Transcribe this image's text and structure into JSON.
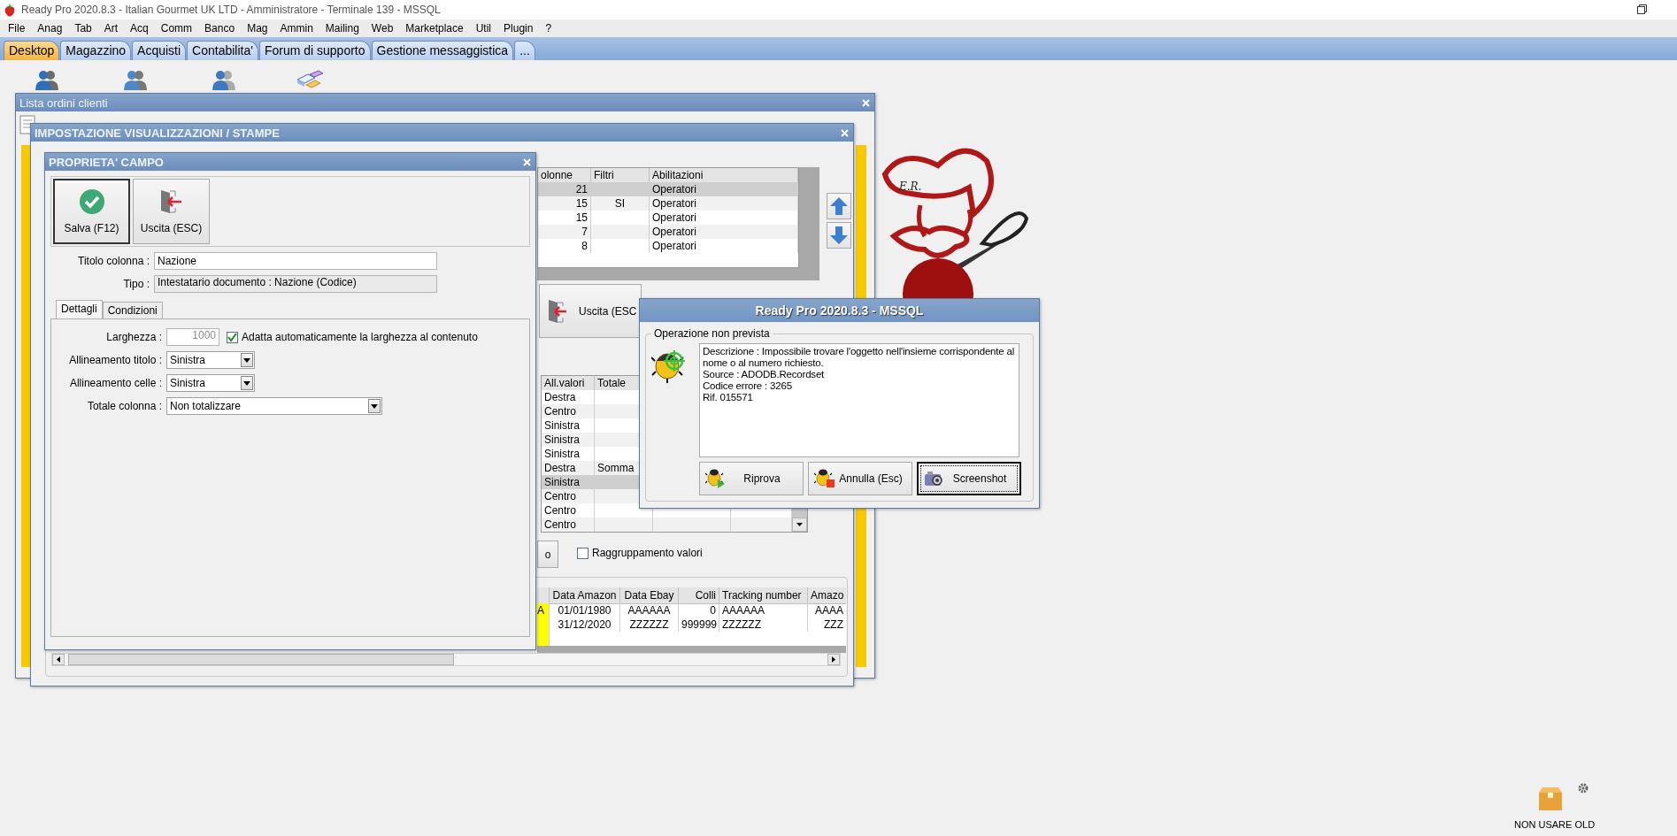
{
  "title_bar": {
    "title": "Ready Pro 2020.8.3 - Italian Gourmet UK LTD - Amministratore - Terminale 139 - MSSQL"
  },
  "menu": [
    "File",
    "Anag",
    "Tab",
    "Art",
    "Acq",
    "Comm",
    "Banco",
    "Mag",
    "Ammin",
    "Mailing",
    "Web",
    "Marketplace",
    "Util",
    "Plugin",
    "?"
  ],
  "tabs": [
    {
      "label": "Desktop",
      "selected": true
    },
    {
      "label": "Magazzino",
      "selected": false
    },
    {
      "label": "Acquisti",
      "selected": false
    },
    {
      "label": "Contabilita'",
      "selected": false
    },
    {
      "label": "Forum di supporto",
      "selected": false
    },
    {
      "label": "Gestione messaggistica",
      "selected": false
    },
    {
      "label": "...",
      "selected": false
    }
  ],
  "orders_window": {
    "title": "Lista ordini clienti"
  },
  "settings_window": {
    "title": "IMPOSTAZIONE VISUALIZZAZIONI / STAMPE",
    "columns_grid": {
      "columns": [
        "olonne",
        "Filtri",
        "Abilitazioni"
      ],
      "rows": [
        {
          "colonne": "21",
          "abilitazioni": "Operatori",
          "selected": true
        },
        {
          "colonne": "15",
          "filtri": "SI",
          "abilitazioni": "Operatori",
          "selected": false
        },
        {
          "colonne": "15",
          "abilitazioni": "Operatori",
          "selected": false
        },
        {
          "colonne": "7",
          "abilitazioni": "Operatori",
          "selected": false
        },
        {
          "colonne": "8",
          "abilitazioni": "Operatori",
          "selected": false
        }
      ]
    },
    "exit_button": "Uscita (ESC",
    "values_grid": {
      "columns": [
        "All.valori",
        "Totale"
      ],
      "rows": [
        {
          "all_valori": "Destra",
          "selected": false
        },
        {
          "all_valori": "Centro",
          "selected": false
        },
        {
          "all_valori": "Sinistra",
          "selected": false
        },
        {
          "all_valori": "Sinistra",
          "selected": false
        },
        {
          "all_valori": "Sinistra",
          "selected": false
        },
        {
          "all_valori": "Destra",
          "totale": "Somma",
          "selected": false
        },
        {
          "all_valori": "Sinistra",
          "selected": true
        },
        {
          "all_valori": "Centro",
          "selected": false
        },
        {
          "all_valori": "Centro",
          "selected": false
        },
        {
          "all_valori": "Centro",
          "selected": false
        }
      ]
    },
    "partial_button": "o",
    "group_values": {
      "label": "Raggruppamento valori",
      "checked": false
    },
    "preview_grid": {
      "columns": [
        "Data Amazon",
        "Data Ebay",
        "Colli",
        "Tracking number",
        "Amazo"
      ],
      "rows": [
        {
          "lead": "A",
          "cells": [
            "01/01/1980",
            "AAAAAA",
            "0",
            "AAAAAA",
            "AAAA"
          ]
        },
        {
          "cells": [
            "31/12/2020",
            "ZZZZZZ",
            "999999",
            "ZZZZZZ",
            "ZZZ"
          ]
        }
      ]
    }
  },
  "field_window": {
    "title": "PROPRIETA' CAMPO",
    "toolbar": [
      {
        "label": "Salva (F12)",
        "kind": "save",
        "focused": true
      },
      {
        "label": "Uscita (ESC)",
        "kind": "exit",
        "focused": false
      }
    ],
    "column_title": {
      "label": "Titolo colonna :",
      "value": "Nazione"
    },
    "type": {
      "label": "Tipo :",
      "value": "Intestatario documento : Nazione (Codice)"
    },
    "tabs": [
      {
        "label": "Dettagli",
        "selected": true
      },
      {
        "label": "Condizioni",
        "selected": false
      }
    ],
    "width": {
      "label": "Larghezza :",
      "value": "1000",
      "disabled": true
    },
    "autofit": {
      "label": "Adatta automaticamente la larghezza al contenuto",
      "checked": true
    },
    "selects": [
      {
        "label": "Allineamento titolo :",
        "value": "Sinistra",
        "kind": "short"
      },
      {
        "label": "Allineamento celle :",
        "value": "Sinistra",
        "kind": "short"
      },
      {
        "label": "Totale colonna :",
        "value": "Non totalizzare",
        "kind": "long"
      }
    ]
  },
  "error_dialog": {
    "title": "Ready Pro 2020.8.3 - MSSQL",
    "group": "Operazione non prevista",
    "message": "Descrizione : Impossibile trovare l'oggetto nell'insieme corrispondente al nome o al numero richiesto.\nSource : ADODB.Recordset\nCodice errore : 3265\nRif. 015571",
    "buttons": [
      {
        "label": "Riprova",
        "kind": "retry",
        "focused": false
      },
      {
        "label": "Annulla (Esc)",
        "kind": "cancel",
        "focused": false
      },
      {
        "label": "Screenshot",
        "kind": "screenshot",
        "focused": true
      }
    ]
  },
  "logo": {
    "text": "E.R."
  },
  "desktop_shortcut": {
    "label": "NON USARE OLD"
  }
}
